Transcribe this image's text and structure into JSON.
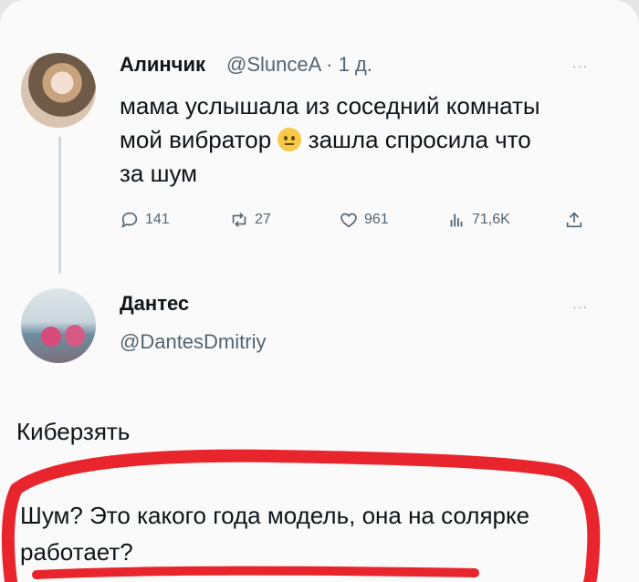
{
  "tweet": {
    "author_name": "Алинчик",
    "author_meta": "@SlunceA · 1 д.",
    "more": "···",
    "text_before_emoji": "мама услышала из соседний комнаты мой вибратор",
    "text_after_emoji": " зашла спросила что за шум",
    "emoji": "neutral-face-emoji",
    "actions": {
      "replies": "141",
      "reposts": "27",
      "likes": "961",
      "views": "71,6K"
    }
  },
  "reply_author": {
    "name": "Дантес",
    "handle": "@DantesDmitriy",
    "more": "···"
  },
  "section_title": "Киберзять",
  "reply_text": "Шум? Это какого года модель, она на солярке работает?",
  "colors": {
    "text": "#0f1419",
    "secondary": "#536471",
    "marker": "#e8252c"
  }
}
